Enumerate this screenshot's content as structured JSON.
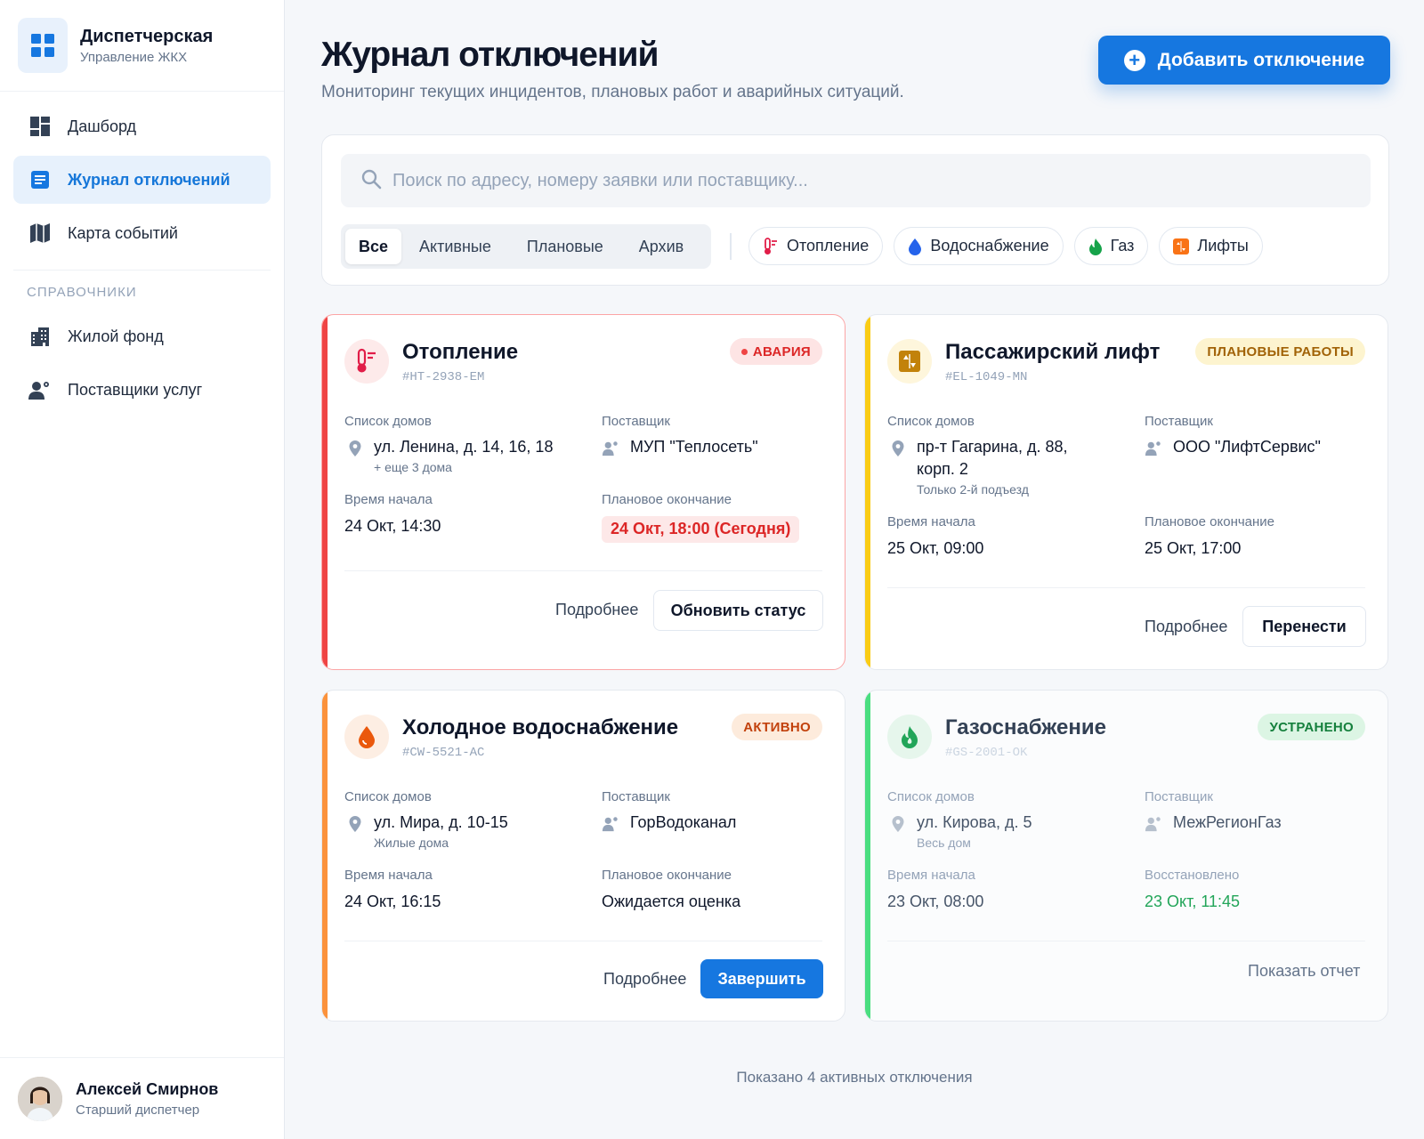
{
  "brand": {
    "title": "Диспетчерская",
    "subtitle": "Управление ЖКХ"
  },
  "nav": {
    "items": [
      {
        "label": "Дашборд",
        "icon": "dashboard-icon"
      },
      {
        "label": "Журнал отключений",
        "icon": "journal-icon",
        "active": true
      },
      {
        "label": "Карта событий",
        "icon": "map-icon"
      }
    ],
    "section": "СПРАВОЧНИКИ",
    "ref_items": [
      {
        "label": "Жилой фонд",
        "icon": "building-icon"
      },
      {
        "label": "Поставщики услуг",
        "icon": "suppliers-icon"
      }
    ]
  },
  "user": {
    "name": "Алексей Смирнов",
    "role": "Старший диспетчер"
  },
  "header": {
    "title": "Журнал отключений",
    "subtitle": "Мониторинг текущих инцидентов, плановых работ и аварийных ситуаций.",
    "add_button": "Добавить отключение"
  },
  "search": {
    "placeholder": "Поиск по адресу, номеру заявки или поставщику..."
  },
  "tabs": [
    "Все",
    "Активные",
    "Плановые",
    "Архив"
  ],
  "filters": [
    "Отопление",
    "Водоснабжение",
    "Газ",
    "Лифты"
  ],
  "labels": {
    "houses": "Список домов",
    "supplier": "Поставщик",
    "start": "Время начала",
    "planned_end": "Плановое окончание",
    "restored": "Восстановлено",
    "details": "Подробнее"
  },
  "cards": [
    {
      "title": "Отопление",
      "id": "#HT-2938-EM",
      "status": "АВАРИЯ",
      "address": "ул. Ленина, д. 14, 16, 18",
      "address_note": "+ еще 3 дома",
      "supplier": "МУП \"Теплосеть\"",
      "start": "24 Окт, 14:30",
      "end": "24 Окт, 18:00 (Сегодня)",
      "action": "Обновить статус",
      "color": "#ef4444"
    },
    {
      "title": "Пассажирский лифт",
      "id": "#EL-1049-MN",
      "status": "ПЛАНОВЫЕ РАБОТЫ",
      "address_line1": "пр-т Гагарина, д. 88,",
      "address_line2": "корп. 2",
      "address_note": "Только 2-й подъезд",
      "supplier": "ООО \"ЛифтСервис\"",
      "start": "25 Окт, 09:00",
      "end": "25 Окт, 17:00",
      "action": "Перенести",
      "color": "#facc15"
    },
    {
      "title": "Холодное водоснабжение",
      "id": "#CW-5521-AC",
      "status": "АКТИВНО",
      "address": "ул. Мира, д. 10-15",
      "address_note": "Жилые дома",
      "supplier": "ГорВодоканал",
      "start": "24 Окт, 16:15",
      "end": "Ожидается оценка",
      "action": "Завершить",
      "color": "#f97316"
    },
    {
      "title": "Газоснабжение",
      "id": "#GS-2001-OK",
      "status": "УСТРАНЕНО",
      "address": "ул. Кирова, д. 5",
      "address_note": "Весь дом",
      "supplier": "МежРегионГаз",
      "start": "23 Окт, 08:00",
      "end": "23 Окт, 11:45",
      "action": "Показать отчет",
      "color": "#4ade80"
    }
  ],
  "footer": "Показано 4 активных отключения"
}
